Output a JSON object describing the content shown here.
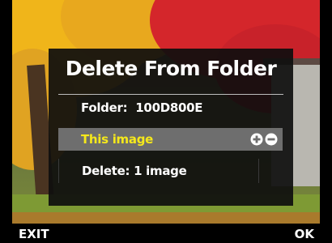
{
  "dialog": {
    "title": "Delete From Folder",
    "folder_label": "Folder:",
    "folder_value": "100D800E",
    "selected_option": "This image",
    "delete_summary": "Delete: 1 image"
  },
  "bottom_bar": {
    "exit_label": "EXIT",
    "ok_label": "OK"
  },
  "icons": {
    "toggle": [
      "plus-circle-icon",
      "minus-circle-icon"
    ]
  },
  "colors": {
    "selected_text": "#f5e81b",
    "selected_row_bg": "#6e6e6e",
    "dialog_bg": "#0e0e0e"
  }
}
